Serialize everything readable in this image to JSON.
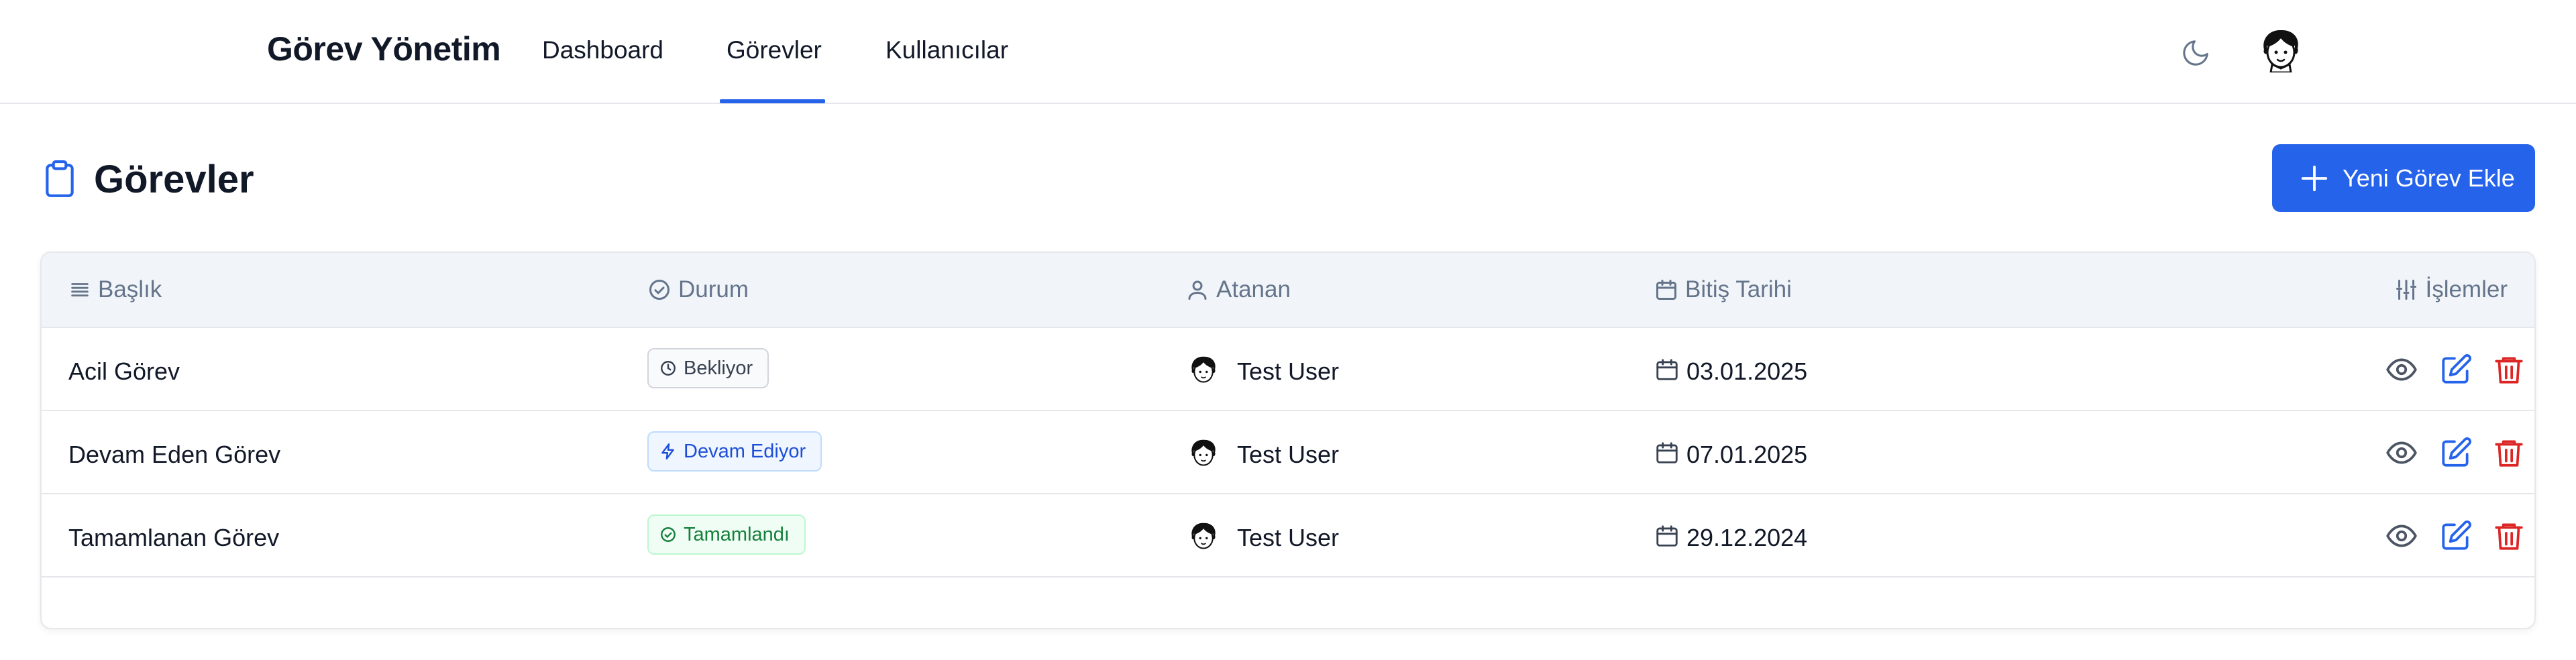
{
  "navbar": {
    "brand": "Görev Yönetim",
    "links": [
      {
        "label": "Dashboard"
      },
      {
        "label": "Görevler",
        "active": true
      },
      {
        "label": "Kullanıcılar"
      }
    ],
    "theme_icon": "moon-icon",
    "avatar_icon": "user-avatar"
  },
  "page": {
    "title": "Görevler",
    "title_icon": "clipboard-icon",
    "add_button": "Yeni Görev Ekle"
  },
  "table": {
    "headers": {
      "title": "Başlık",
      "status": "Durum",
      "assignee": "Atanan",
      "due": "Bitiş Tarihi",
      "actions": "İşlemler"
    },
    "rows": [
      {
        "title": "Acil Görev",
        "status": "Bekliyor",
        "status_type": "waiting",
        "assignee": "Test User",
        "due": "03.01.2025"
      },
      {
        "title": "Devam Eden Görev",
        "status": "Devam Ediyor",
        "status_type": "in-progress",
        "assignee": "Test User",
        "due": "07.01.2025"
      },
      {
        "title": "Tamamlanan Görev",
        "status": "Tamamlandı",
        "status_type": "done",
        "assignee": "Test User",
        "due": "29.12.2024"
      }
    ]
  },
  "colors": {
    "primary": "#2563eb",
    "danger": "#dc2626",
    "header_bg": "#f1f5f9",
    "muted": "#64748b"
  }
}
